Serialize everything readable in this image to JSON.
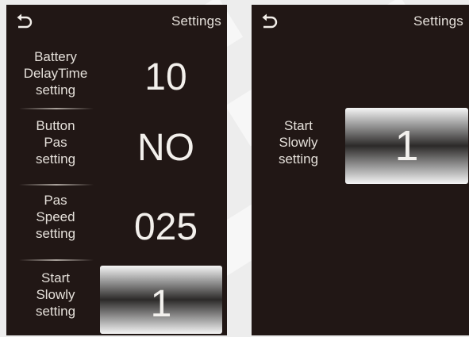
{
  "colors": {
    "screen_background": "#211715",
    "text": "#e5e0da",
    "page_background": "#ededed"
  },
  "left_screen": {
    "title": "Settings",
    "back_icon": "return-arrow-icon",
    "rows": [
      {
        "label_lines": [
          "Battery",
          "DelayTime",
          "setting"
        ],
        "value": "10"
      },
      {
        "label_lines": [
          "Button",
          "Pas",
          "setting"
        ],
        "value": "NO"
      },
      {
        "label_lines": [
          "Pas",
          "Speed",
          "setting"
        ],
        "value": "025"
      },
      {
        "label_lines": [
          "Start",
          "Slowly",
          "setting"
        ],
        "value": "1",
        "selected": true
      }
    ]
  },
  "right_screen": {
    "title": "Settings",
    "back_icon": "return-arrow-icon",
    "label_lines": [
      "Start",
      "Slowly",
      "setting"
    ],
    "value": "1"
  }
}
